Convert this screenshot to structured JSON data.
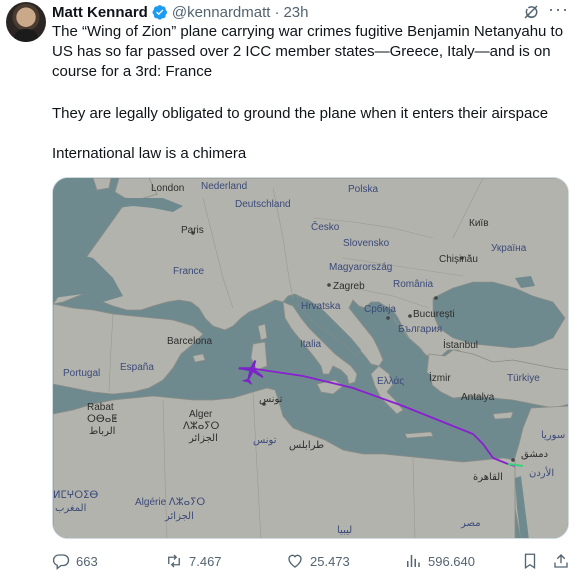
{
  "author": {
    "name": "Matt Kennard",
    "handle": "@kennardmatt",
    "separator": "·",
    "time": "23h"
  },
  "tweet": {
    "paragraph1": "The “Wing of Zion” plane carrying war crimes fugitive Benjamin Netanyahu to US has so far passed over 2 ICC member states—Greece, Italy—and is on course for a 3rd: France",
    "paragraph2": "They are legally obligated to ground the plane when it enters their airspace",
    "paragraph3": "International law is a chimera"
  },
  "map": {
    "labels": {
      "london": "London",
      "nederland": "Nederland",
      "polska": "Polska",
      "deutschland": "Deutschland",
      "paris": "Paris",
      "cesko": "Česko",
      "kyiv": "Київ",
      "slovensko": "Slovensko",
      "ukraina": "Україна",
      "france": "France",
      "magyarorszag": "Magyarország",
      "chisinau": "Chișinău",
      "zagreb": "Zagreb",
      "romania": "România",
      "hrvatska": "Hrvatska",
      "srbija": "Србија",
      "bucuresti": "București",
      "bulgaria": "България",
      "barcelona": "Barcelona",
      "italia": "Italia",
      "istanbul": "İstanbul",
      "portugal": "Portugal",
      "espana": "España",
      "ellas": "Ελλάς",
      "izmir": "İzmir",
      "turkiye": "Türkiye",
      "tunis": "تونس",
      "antalya": "Antalya",
      "rabat": "Rabat",
      "rabat_tif": "ⵔⴱⴰⵟ",
      "rabat_ar": "الرباط",
      "alger": "Alger",
      "alger_tif": "ⴷⵣⴰⵢⵔ",
      "alger_ar": "الجزائر",
      "tunis_country": "تونس",
      "tripoli": "طرابلس",
      "suriya": "سوريا",
      "dimashq": "دمشق",
      "urdun": "الأردن",
      "qahira": "القاهرة",
      "morocco_tif": "ⵍⵎⵖⵔⵉⴱ",
      "morocco_ar": "المغرب",
      "algerie": "Algérie ⴷⵣⴰⵢⵔ",
      "algerie_ar": "الجزائر",
      "libya": "ليبيا",
      "misr": "مصر"
    },
    "route_color": "#8a1fd1",
    "plane_color": "#7a23c8"
  },
  "actions": {
    "replies": "663",
    "retweets": "7.467",
    "likes": "25.473",
    "views": "596.640"
  },
  "colors": {
    "verified": "#1d9bf0",
    "muted": "#536471",
    "sea": "#6f8a8e",
    "land": "#b3b3ad"
  }
}
